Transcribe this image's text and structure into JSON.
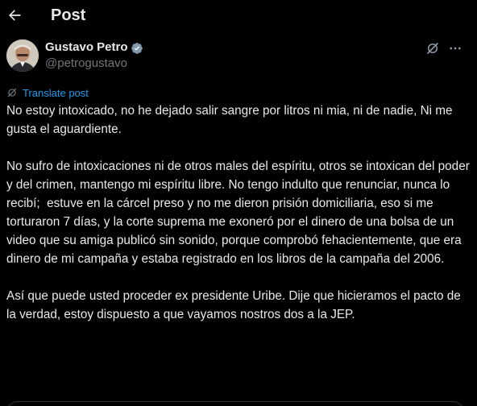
{
  "header": {
    "title": "Post",
    "back_icon": "arrow-left-icon"
  },
  "post": {
    "author_name": "Gustavo Petro",
    "handle": "@petrogustavo",
    "verified": true,
    "translate_label": "Translate post",
    "paragraphs": [
      "No estoy intoxicado, no he dejado salir sangre por litros ni mia, ni de nadie, Ni me gusta el aguardiente.",
      "No sufro de intoxicaciones ni de otros males del espíritu, otros se intoxican del poder y del crimen, mantengo mi espíritu libre. No tengo indulto que renunciar, nunca lo recibí;  estuve en la cárcel preso y no me dieron prisión domiciliaria, eso si me torturaron 7 días, y la corte suprema me exoneró por el dinero de una bolsa de un video que su amiga publicó sin sonido, porque comprobó fehacientemente, que era dinero de mi campaña y estaba registrado en los libros de la campaña del 2006.",
      "Así que puede usted proceder ex presidente Uribe. Dije que hicieramos el pacto de la verdad, estoy dispuesto a que vayamos nostros dos a la JEP."
    ]
  },
  "colors": {
    "background": "#000000",
    "text": "#e7e9ea",
    "secondary": "#71767b",
    "accent": "#1d9bf0"
  }
}
